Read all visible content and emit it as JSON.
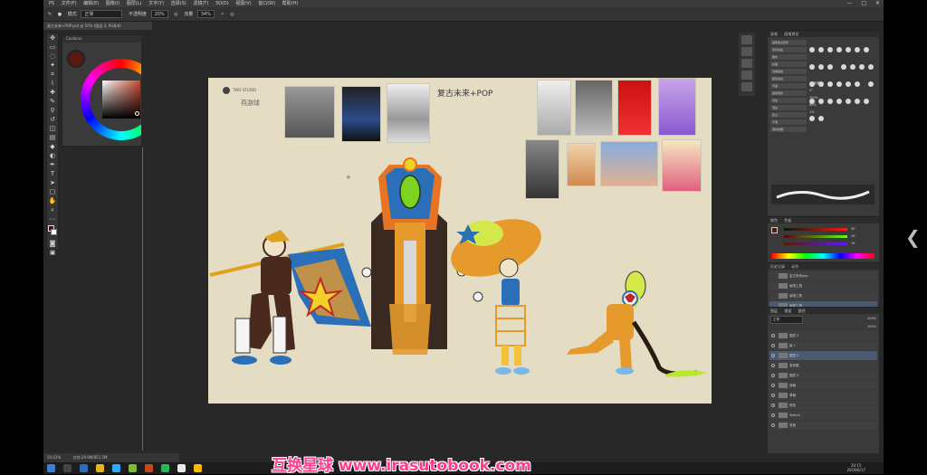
{
  "window": {
    "menu": [
      "PS",
      "文件(F)",
      "编辑(E)",
      "图像(I)",
      "图层(L)",
      "文字(Y)",
      "选择(S)",
      "滤镜(T)",
      "3D(D)",
      "视图(V)",
      "窗口(W)",
      "帮助(H)"
    ],
    "controls": [
      "—",
      "□",
      "✕"
    ]
  },
  "options_bar": {
    "mode_label": "模式",
    "mode_value": "正常",
    "opacity_label": "不透明度",
    "opacity_value": "20%",
    "flow_label": "流量",
    "flow_value": "34%"
  },
  "doc_tab": "复古未来+POP.psd @ 50% (图层 4, RGB/8)",
  "color_wheel_panel": {
    "title": "Coolorus"
  },
  "artboard": {
    "studio": "TWO STUDIO",
    "author": "燕游球",
    "headline": "复古未来+POP"
  },
  "status_bar": {
    "zoom": "50.03%",
    "info": "文档:29.9M/851.5M"
  },
  "right_panels": {
    "brush_tabs": [
      "画笔",
      "画笔预设"
    ],
    "brush_list": [
      "画笔笔尖形状",
      "形状动态",
      "散布",
      "纹理",
      "双重画笔",
      "颜色动态",
      "传递",
      "画笔笔势",
      "杂色",
      "湿边",
      "建立",
      "平滑",
      "保护纹理"
    ],
    "brush_values": {
      "size": "25像素",
      "angle": "0°",
      "roundness": "100%",
      "hardness": "80%",
      "spacing": "1%"
    },
    "color_tabs": [
      "颜色",
      "色板"
    ],
    "rgb": {
      "r": "90",
      "g": "26",
      "b": "16"
    },
    "history_tabs": [
      "历史记录",
      "动作"
    ],
    "history_items": [
      "复古未来pop",
      "画笔工具",
      "画笔工具",
      "画笔工具"
    ],
    "layers_tabs": [
      "图层",
      "通道",
      "路径"
    ],
    "blend_mode": "正常",
    "layer_opacity": "100%",
    "layer_fill": "100%",
    "layers": [
      "图层 3",
      "组 1",
      "图层 4",
      "参考图",
      "图层 2",
      "线稿",
      "草稿",
      "底色",
      "Sketch",
      "背景"
    ]
  },
  "taskbar": {
    "time": "20:15",
    "date": "2019/6/17"
  },
  "watermark": "互换星球 www.irasutobook.com"
}
